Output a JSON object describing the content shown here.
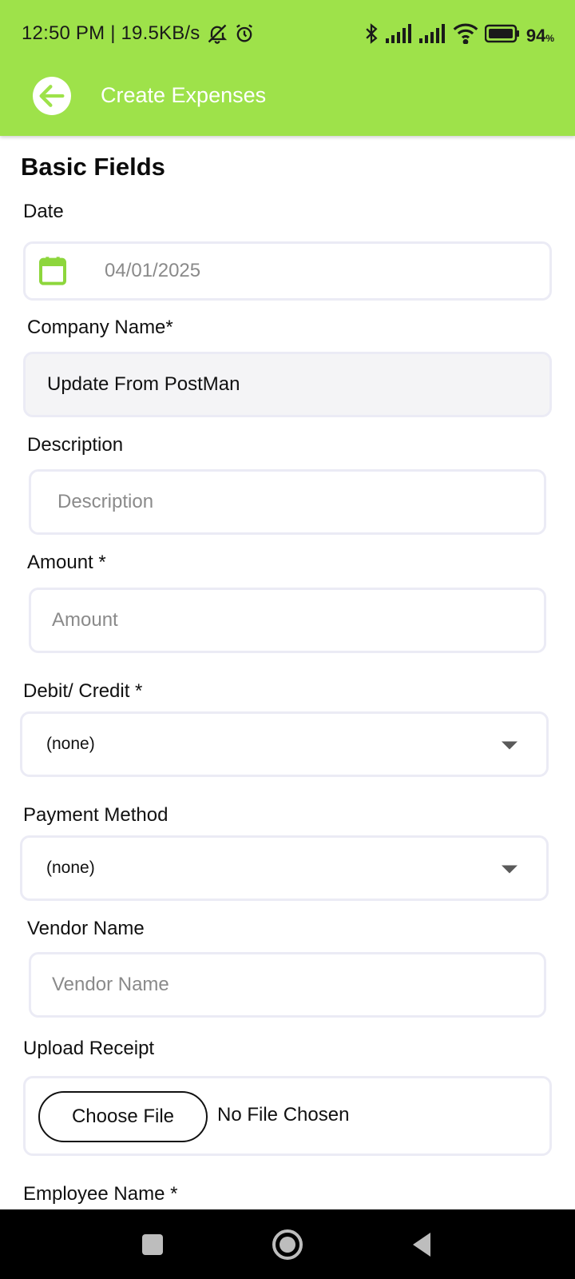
{
  "status_bar": {
    "time": "12:50 PM | 19.5KB/s",
    "battery_percent": "94",
    "battery_unit": "%"
  },
  "app_bar": {
    "title": "Create Expenses",
    "back_icon": "back-arrow-icon"
  },
  "form": {
    "section_title": "Basic Fields",
    "date": {
      "label": "Date",
      "value": "04/01/2025",
      "icon": "calendar-icon"
    },
    "company_name": {
      "label": "Company Name*",
      "value": "Update From PostMan"
    },
    "description": {
      "label": "Description",
      "placeholder": "Description"
    },
    "amount": {
      "label": "Amount *",
      "placeholder": "Amount"
    },
    "debit_credit": {
      "label": "Debit/ Credit *",
      "selected": "(none)"
    },
    "payment_method": {
      "label": "Payment Method",
      "selected": "(none)"
    },
    "vendor_name": {
      "label": "Vendor Name",
      "placeholder": "Vendor Name"
    },
    "upload_receipt": {
      "label": "Upload Receipt",
      "button_label": "Choose File",
      "status": "No File Chosen"
    },
    "employee_name": {
      "label": "Employee Name *"
    }
  },
  "colors": {
    "header_green": "#9ee24a",
    "field_border": "#ebebf5",
    "calendar_green": "#8dd63c"
  },
  "nav_bar": {
    "recents_icon": "square-icon",
    "home_icon": "circle-home-icon",
    "back_icon": "triangle-back-icon"
  }
}
